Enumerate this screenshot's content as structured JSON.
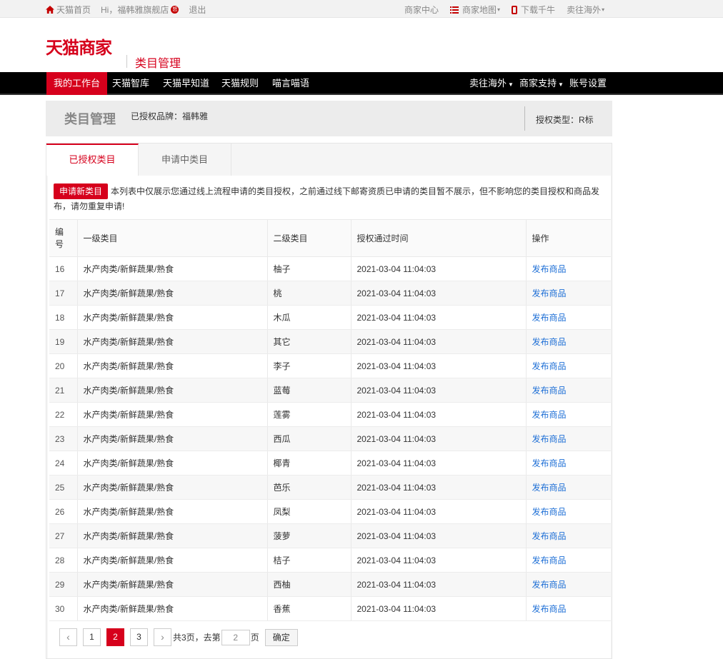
{
  "topbar": {
    "home": "天猫首页",
    "greeting": "Hi，福韩雅旗舰店",
    "vip_badge": "怒",
    "logout": "退出",
    "merchant_center": "商家中心",
    "merchant_map": "商家地图",
    "download_qianniu": "下载千牛",
    "sell_overseas": "卖往海外"
  },
  "header": {
    "logo": "天猫商家",
    "subtitle": "类目管理"
  },
  "nav": {
    "items": [
      "我的工作台",
      "天猫智库",
      "天猫早知道",
      "天猫规则",
      "喵言喵语"
    ],
    "right": [
      "卖往海外",
      "商家支持",
      "账号设置"
    ]
  },
  "titlebox": {
    "title": "类目管理",
    "brand": "已授权品牌：福韩雅",
    "auth_type": "授权类型：R标"
  },
  "tabs": [
    "已授权类目",
    "申请中类目"
  ],
  "notice": {
    "button": "申请新类目",
    "text": "本列表中仅展示您通过线上流程申请的类目授权，之前通过线下邮寄资质已申请的类目暂不展示，但不影响您的类目授权和商品发布，请勿重复申请!"
  },
  "table": {
    "headers": [
      "编号",
      "一级类目",
      "二级类目",
      "授权通过时间",
      "操作"
    ],
    "rows": [
      [
        "16",
        "水产肉类/新鲜蔬果/熟食",
        "柚子",
        "2021-03-04 11:04:03",
        "发布商品"
      ],
      [
        "17",
        "水产肉类/新鲜蔬果/熟食",
        "桃",
        "2021-03-04 11:04:03",
        "发布商品"
      ],
      [
        "18",
        "水产肉类/新鲜蔬果/熟食",
        "木瓜",
        "2021-03-04 11:04:03",
        "发布商品"
      ],
      [
        "19",
        "水产肉类/新鲜蔬果/熟食",
        "其它",
        "2021-03-04 11:04:03",
        "发布商品"
      ],
      [
        "20",
        "水产肉类/新鲜蔬果/熟食",
        "李子",
        "2021-03-04 11:04:03",
        "发布商品"
      ],
      [
        "21",
        "水产肉类/新鲜蔬果/熟食",
        "蓝莓",
        "2021-03-04 11:04:03",
        "发布商品"
      ],
      [
        "22",
        "水产肉类/新鲜蔬果/熟食",
        "莲雾",
        "2021-03-04 11:04:03",
        "发布商品"
      ],
      [
        "23",
        "水产肉类/新鲜蔬果/熟食",
        "西瓜",
        "2021-03-04 11:04:03",
        "发布商品"
      ],
      [
        "24",
        "水产肉类/新鲜蔬果/熟食",
        "椰青",
        "2021-03-04 11:04:03",
        "发布商品"
      ],
      [
        "25",
        "水产肉类/新鲜蔬果/熟食",
        "芭乐",
        "2021-03-04 11:04:03",
        "发布商品"
      ],
      [
        "26",
        "水产肉类/新鲜蔬果/熟食",
        "凤梨",
        "2021-03-04 11:04:03",
        "发布商品"
      ],
      [
        "27",
        "水产肉类/新鲜蔬果/熟食",
        "菠萝",
        "2021-03-04 11:04:03",
        "发布商品"
      ],
      [
        "28",
        "水产肉类/新鲜蔬果/熟食",
        "桔子",
        "2021-03-04 11:04:03",
        "发布商品"
      ],
      [
        "29",
        "水产肉类/新鲜蔬果/熟食",
        "西柚",
        "2021-03-04 11:04:03",
        "发布商品"
      ],
      [
        "30",
        "水产肉类/新鲜蔬果/熟食",
        "香蕉",
        "2021-03-04 11:04:03",
        "发布商品"
      ]
    ]
  },
  "pager": {
    "prev": "‹",
    "next": "›",
    "pages": [
      "1",
      "2",
      "3"
    ],
    "current": "2",
    "total_text": "共3页，去第",
    "page_unit": "页",
    "input_value": "2",
    "confirm": "确定"
  },
  "colors": {
    "accent": "#d6001c",
    "link": "#1e6fd6"
  },
  "icons": [
    "home-icon",
    "list-icon",
    "phone-icon"
  ]
}
